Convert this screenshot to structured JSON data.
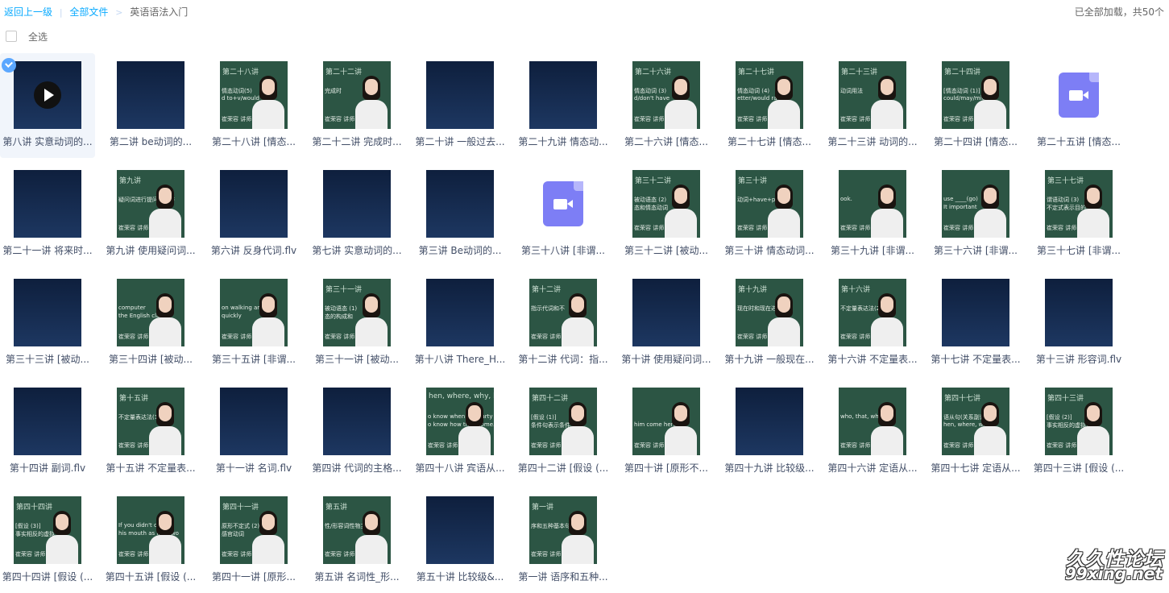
{
  "breadcrumb": {
    "back": "返回上一级",
    "all_files": "全部文件",
    "current": "英语语法入门",
    "separator_1": "|",
    "separator_2": ">"
  },
  "status_text": "已全部加载，共50个",
  "select_all_label": "全选",
  "colors": {
    "accent": "#09aaff",
    "video_icon": "#7d7ef5",
    "board": "#2c5544",
    "dark_thumb": "#14284a"
  },
  "files": [
    {
      "name": "第八讲 实意动词的...",
      "thumb": "play",
      "selected": true
    },
    {
      "name": "第二讲 be动词的...",
      "thumb": "dark"
    },
    {
      "name": "第二十八讲 [情态...",
      "thumb": "board",
      "board_title": "第二十八讲",
      "board_line1": "情态动词(5)",
      "board_line2": "d to+v/would"
    },
    {
      "name": "第二十二讲 完成时...",
      "thumb": "board",
      "board_title": "第二十二讲",
      "board_line1": "完成时",
      "board_line2": ""
    },
    {
      "name": "第二十讲 一般过去...",
      "thumb": "dark"
    },
    {
      "name": "第二十九讲 情态动...",
      "thumb": "dark"
    },
    {
      "name": "第二十六讲 [情态...",
      "thumb": "board",
      "board_title": "第二十六讲",
      "board_line1": "情态动词 (3)",
      "board_line2": "d/don't have"
    },
    {
      "name": "第二十七讲 [情态...",
      "thumb": "board",
      "board_title": "第二十七讲",
      "board_line1": "情态动词 (4)",
      "board_line2": "etter/would ra"
    },
    {
      "name": "第二十三讲 动词的...",
      "thumb": "board",
      "board_title": "第二十三讲",
      "board_line1": "动词用法",
      "board_line2": ""
    },
    {
      "name": "第二十四讲 [情态...",
      "thumb": "board",
      "board_title": "第二十四讲",
      "board_line1": "[情态动词 (1)]",
      "board_line2": "could/may/might"
    },
    {
      "name": "第二十五讲 [情态...",
      "thumb": "video"
    },
    {
      "name": "第二十一讲 将来时...",
      "thumb": "dark"
    },
    {
      "name": "第九讲 使用疑问词...",
      "thumb": "board",
      "board_title": "第九讲",
      "board_line1": "疑问词进行提问和回答",
      "board_line2": ""
    },
    {
      "name": "第六讲 反身代词.flv",
      "thumb": "dark"
    },
    {
      "name": "第七讲 实意动词的...",
      "thumb": "dark"
    },
    {
      "name": "第三讲 Be动词的...",
      "thumb": "dark"
    },
    {
      "name": "第三十八讲 [非谓...",
      "thumb": "video"
    },
    {
      "name": "第三十二讲 [被动...",
      "thumb": "board",
      "board_title": "第三十二讲",
      "board_line1": "被动语态 (2)",
      "board_line2": "态和情态动词"
    },
    {
      "name": "第三十讲 情态动词...",
      "thumb": "board",
      "board_title": "第三十讲",
      "board_line1": "动词+have+p.p.",
      "board_line2": ""
    },
    {
      "name": "第三十九讲 [非谓...",
      "thumb": "board",
      "board_title": "",
      "board_line1": "ook.",
      "board_line2": ""
    },
    {
      "name": "第三十六讲 [非谓...",
      "thumb": "board",
      "board_title": "",
      "board_line1": "use ____(go)",
      "board_line2": "It important"
    },
    {
      "name": "第三十七讲 [非谓...",
      "thumb": "board",
      "board_title": "第三十七讲",
      "board_line1": "谓语动词 (3)",
      "board_line2": "不定式表示目的"
    },
    {
      "name": "第三十三讲 [被动...",
      "thumb": "dark"
    },
    {
      "name": "第三十四讲 [被动...",
      "thumb": "board",
      "board_title": "",
      "board_line1": "computer",
      "board_line2": "the English class"
    },
    {
      "name": "第三十五讲 [非谓...",
      "thumb": "board",
      "board_title": "",
      "board_line1": "on walking and",
      "board_line2": "quickly"
    },
    {
      "name": "第三十一讲 [被动...",
      "thumb": "board",
      "board_title": "第三十一讲",
      "board_line1": "被动语态 (1)",
      "board_line2": "态的构成和"
    },
    {
      "name": "第十八讲 There_H...",
      "thumb": "dark"
    },
    {
      "name": "第十二讲 代词：指...",
      "thumb": "board",
      "board_title": "第十二讲",
      "board_line1": "指示代词和不",
      "board_line2": ""
    },
    {
      "name": "第十讲 使用疑问词...",
      "thumb": "dark"
    },
    {
      "name": "第十九讲 一般现在...",
      "thumb": "board",
      "board_title": "第十九讲",
      "board_line1": "现在时和现在进",
      "board_line2": ""
    },
    {
      "name": "第十六讲 不定量表...",
      "thumb": "board",
      "board_title": "第十六讲",
      "board_line1": "不定量表达法(2)",
      "board_line2": ""
    },
    {
      "name": "第十七讲 不定量表...",
      "thumb": "dark"
    },
    {
      "name": "第十三讲 形容词.flv",
      "thumb": "dark"
    },
    {
      "name": "第十四讲 副词.flv",
      "thumb": "dark"
    },
    {
      "name": "第十五讲 不定量表...",
      "thumb": "board",
      "board_title": "第十五讲",
      "board_line1": "不定量表达法(1)",
      "board_line2": ""
    },
    {
      "name": "第十一讲 名词.flv",
      "thumb": "dark"
    },
    {
      "name": "第四讲 代词的主格...",
      "thumb": "dark"
    },
    {
      "name": "第四十八讲 宾语从...",
      "thumb": "board",
      "board_title": "hen, where, why, how",
      "board_line1": "o know when the party is",
      "board_line2": "o know how they come."
    },
    {
      "name": "第四十二讲 [假设 (...",
      "thumb": "board",
      "board_title": "第四十二讲",
      "board_line1": "[假设 (1)]",
      "board_line2": "条件句表示条件"
    },
    {
      "name": "第四十讲 [原形不...",
      "thumb": "board",
      "board_title": "",
      "board_line1": "",
      "board_line2": "him come here."
    },
    {
      "name": "第四十九讲 比较级...",
      "thumb": "dark"
    },
    {
      "name": "第四十六讲 定语从...",
      "thumb": "board",
      "board_title": "",
      "board_line1": "who, that, which",
      "board_line2": ""
    },
    {
      "name": "第四十七讲 定语从...",
      "thumb": "board",
      "board_title": "第四十七讲",
      "board_line1": "语从句(关系副词)",
      "board_line2": "hen, where, wh"
    },
    {
      "name": "第四十三讲 [假设 (...",
      "thumb": "board",
      "board_title": "第四十三讲",
      "board_line1": "[假设 (2)]",
      "board_line2": "事实相反的虚拟语气"
    },
    {
      "name": "第四十四讲 [假设 (...",
      "thumb": "board",
      "board_title": "第四十四讲",
      "board_line1": "[假设 (3)]",
      "board_line2": "事实相反的虚拟"
    },
    {
      "name": "第四十五讲 [假设 (...",
      "thumb": "board",
      "board_title": "",
      "board_line1": "If you didn't care",
      "board_line2": "his mouth as if he wo"
    },
    {
      "name": "第四十一讲 [原形...",
      "thumb": "board",
      "board_title": "第四十一讲",
      "board_line1": "原形不定式 (2)",
      "board_line2": "感官动词"
    },
    {
      "name": "第五讲 名词性_形...",
      "thumb": "board",
      "board_title": "第五讲",
      "board_line1": "性/形容词性物主代",
      "board_line2": ""
    },
    {
      "name": "第五十讲 比较级&...",
      "thumb": "dark"
    },
    {
      "name": "第一讲 语序和五种...",
      "thumb": "board",
      "board_title": "第一讲",
      "board_line1": "序和五种基本句",
      "board_line2": ""
    }
  ],
  "teacher_caption": "崔荣容  讲师",
  "watermark": {
    "line1": "久久性论坛",
    "line2": "99xing.net"
  }
}
